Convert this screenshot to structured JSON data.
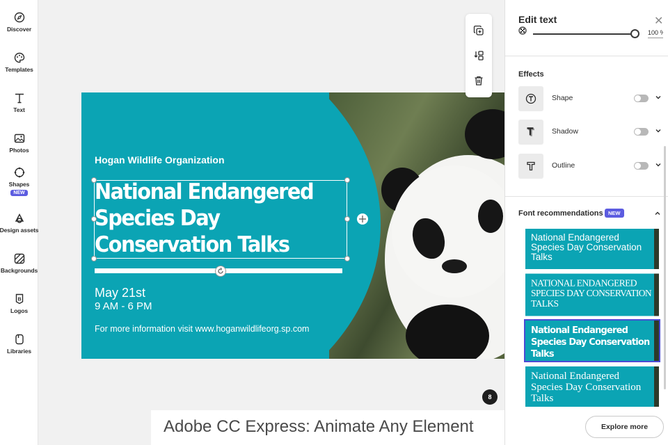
{
  "rail": {
    "items": [
      {
        "label": "Discover",
        "icon": "compass-icon"
      },
      {
        "label": "Templates",
        "icon": "palette-icon"
      },
      {
        "label": "Text",
        "icon": "text-icon"
      },
      {
        "label": "Photos",
        "icon": "image-icon"
      },
      {
        "label": "Shapes",
        "icon": "shapes-icon",
        "badge": "NEW"
      },
      {
        "label": "Design assets",
        "icon": "design-assets-icon"
      },
      {
        "label": "Backgrounds",
        "icon": "backgrounds-icon"
      },
      {
        "label": "Logos",
        "icon": "logo-icon"
      },
      {
        "label": "Libraries",
        "icon": "libraries-icon"
      }
    ]
  },
  "design": {
    "org": "Hogan Wildlife Organization",
    "headline": "National Endangered Species Day Conservation Talks",
    "date": "May 21st",
    "time": "9 AM - 6 PM",
    "info": "For more information visit www.hoganwildlifeorg.sp.com"
  },
  "page_number": "8",
  "caption": "Adobe CC Express: Animate Any Element",
  "panel": {
    "title": "Edit text",
    "opacity_value": "100 %",
    "effects_title": "Effects",
    "effects": [
      {
        "label": "Shape",
        "enabled": false
      },
      {
        "label": "Shadow",
        "enabled": false
      },
      {
        "label": "Outline",
        "enabled": false
      }
    ],
    "font_rec_title": "Font recommendations",
    "font_rec_badge": "NEW",
    "font_cards": [
      "National Endangered Species Day Conservation Talks",
      "NATIONAL ENDANGERED SPECIES DAY CONSERVATION TALKS",
      "National Endangered Species Day Conservation Talks",
      "National Endangered Species Day Conservation Talks"
    ],
    "explore_label": "Explore more"
  },
  "colors": {
    "brand_teal": "#0ba4b4",
    "accent_purple": "#5c5ce0"
  }
}
